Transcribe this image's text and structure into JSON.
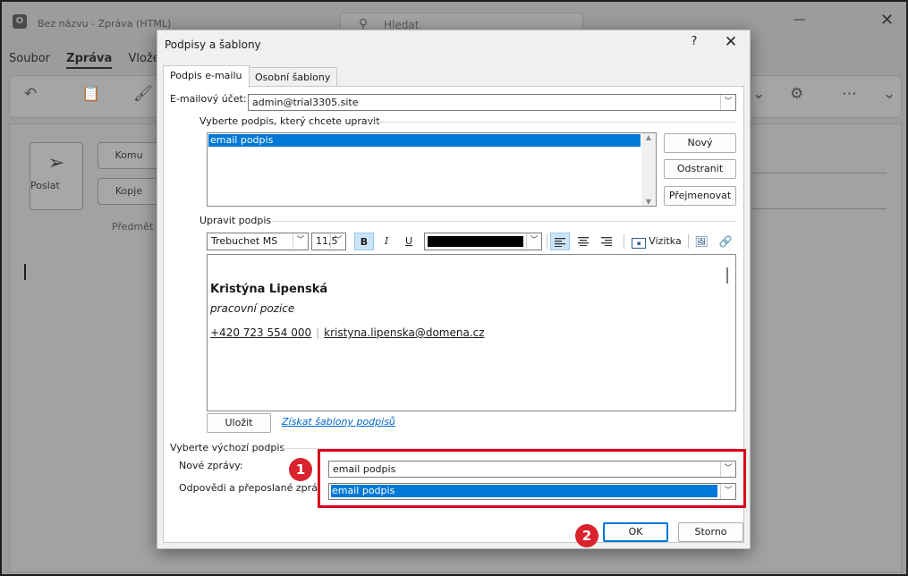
{
  "background_window": {
    "title": "Bez názvu  -  Zpráva (HTML)",
    "search_placeholder": "Hledat",
    "menu": [
      "Soubor",
      "Zpráva",
      "Vložení"
    ],
    "send_label": "Poslat",
    "to_label": "Komu",
    "cc_label": "Kopje",
    "subject_label": "Předmět"
  },
  "dialog": {
    "title": "Podpisy a šablony",
    "help_glyph": "?",
    "close_glyph": "✕",
    "tabs": [
      "Podpis e-mailu",
      "Osobní šablony"
    ],
    "account_label": "E-mailový účet:",
    "account_value": "admin@trial3305.site",
    "select_label": "Vyberte podpis, který chcete upravit",
    "signatures": [
      "email podpis"
    ],
    "new_button": "Nový",
    "delete_button": "Odstranit",
    "rename_button": "Přejmenovat",
    "edit_label": "Upravit podpis",
    "font_name": "Trebuchet MS",
    "font_size": "11,5",
    "bold_label": "B",
    "italic_label": "I",
    "underline_label": "U",
    "text_color": "#000000",
    "card_button": "Vizitka",
    "signature": {
      "name": "Kristýna Lipenská",
      "position": "pracovní pozice",
      "phone": "+420 723 554 000",
      "separator": "|",
      "email": "kristyna.lipenska@domena.cz"
    },
    "save_button": "Uložit",
    "get_templates_link": "Získat šablony podpisů",
    "default_section_label": "Vyberte výchozí podpis",
    "new_messages_label": "Nové zprávy:",
    "new_messages_value": "email podpis",
    "replies_label": "Odpovědi a přeposlané zprávy:",
    "replies_value": "email podpis",
    "ok_button": "OK",
    "cancel_button": "Storno"
  },
  "annotations": {
    "callout_color": "#d7001a",
    "badge_1": "1",
    "badge_2": "2"
  }
}
